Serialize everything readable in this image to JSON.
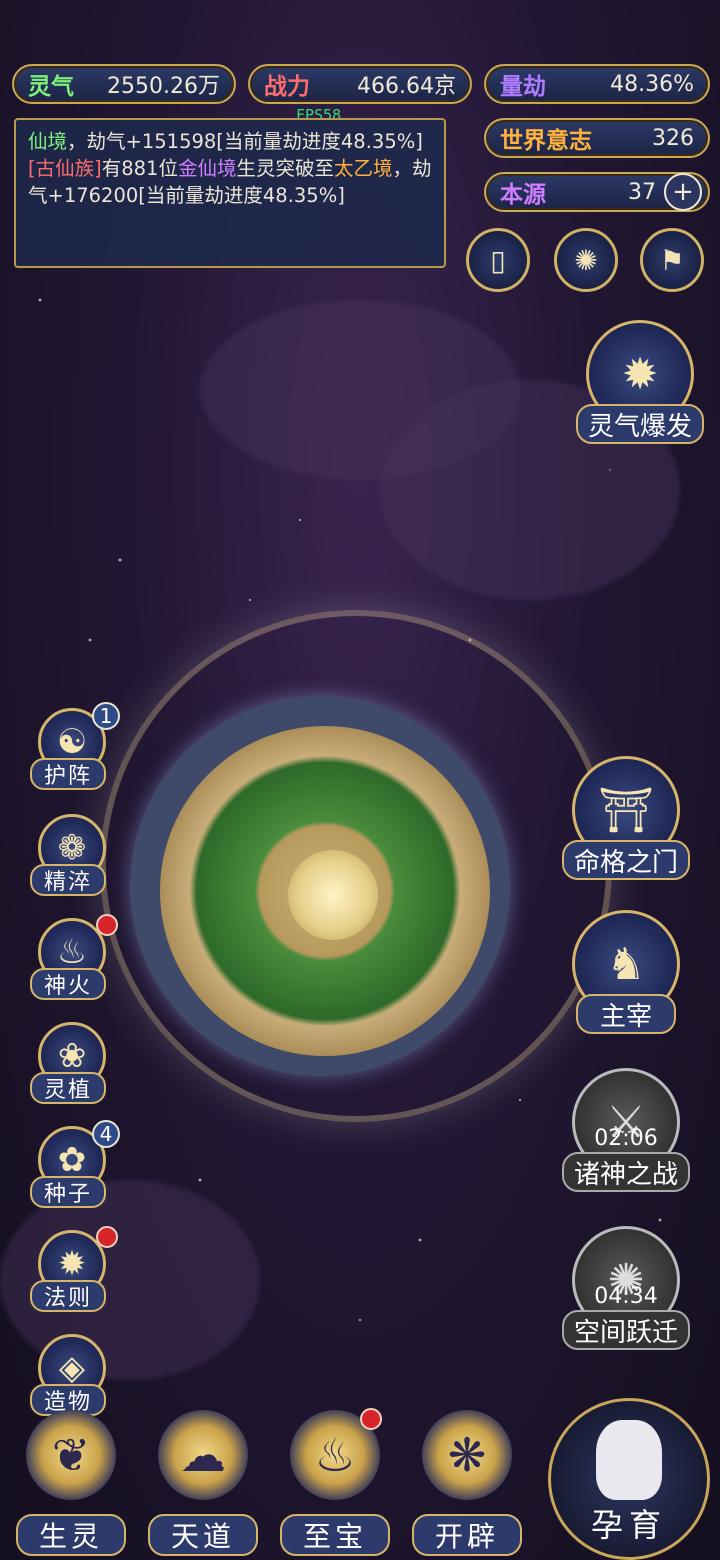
{
  "resources": {
    "lingqi": {
      "label": "灵气",
      "value": "2550.26万"
    },
    "zhanli": {
      "label": "战力",
      "value": "466.64京"
    },
    "liangjie": {
      "label": "量劫",
      "value": "48.36%"
    },
    "shijie": {
      "label": "世界意志",
      "value": "326"
    },
    "benyuan": {
      "label": "本源",
      "value": "37"
    }
  },
  "fps": "FPS58",
  "log": {
    "line1_a": "仙境",
    "line1_b": "，劫气+151598[当前量劫进度48.35%]",
    "line2_a": "[古仙族]",
    "line2_b": "有881位",
    "line2_c": "金仙境",
    "line2_d": "生灵突破至",
    "line2_e": "太乙境",
    "line2_f": "，劫气+176200[当前量劫进度48.35%]"
  },
  "left_menu": [
    {
      "label": "护阵",
      "icon": "☯",
      "badge": "1"
    },
    {
      "label": "精淬",
      "icon": "❁",
      "badge": ""
    },
    {
      "label": "神火",
      "icon": "♨",
      "badge": "dot"
    },
    {
      "label": "灵植",
      "icon": "❀",
      "badge": ""
    },
    {
      "label": "种子",
      "icon": "✿",
      "badge": "4"
    },
    {
      "label": "法则",
      "icon": "✹",
      "badge": "dot"
    },
    {
      "label": "造物",
      "icon": "◈",
      "badge": ""
    }
  ],
  "right_menu": {
    "burst": "灵气爆发",
    "mingge": "命格之门",
    "zhuzai": "主宰",
    "zhushen": "诸神之战",
    "zhushen_timer": "02:06",
    "kongjian": "空间跃迁",
    "kongjian_timer": "04:34"
  },
  "bottom_menu": {
    "shengling": "生灵",
    "tiandao": "天道",
    "zhibao": "至宝",
    "kaipi": "开辟",
    "yunyu": "孕育"
  },
  "colors": {
    "gold": "#d6b56a",
    "panel": "#2d3a6c",
    "lingqi_label": "#7ef07a",
    "zhanli_label": "#ff6c6c",
    "liangjie_label": "#b07cff",
    "shijie_label": "#ffb13b",
    "benyuan_label": "#d07cff"
  }
}
